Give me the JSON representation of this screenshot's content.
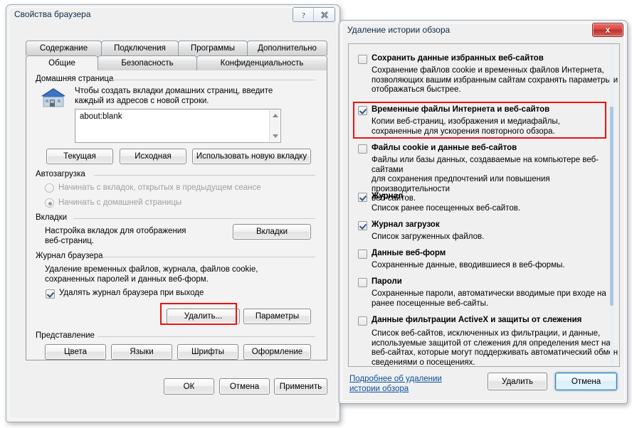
{
  "browser_properties": {
    "title": "Свойства браузера",
    "caption_buttons": [
      {
        "name": "help-button",
        "glyph": "?"
      },
      {
        "name": "close-button",
        "glyph": "✕"
      }
    ],
    "tabs_row1": [
      "Содержание",
      "Подключения",
      "Программы",
      "Дополнительно"
    ],
    "tabs_row2": [
      "Общие",
      "Безопасность",
      "Конфиденциальность"
    ],
    "selected_tab": "Общие",
    "home_page": {
      "group_label": "Домашняя страница",
      "icon": "house-icon",
      "description_line1": "Чтобы создать вкладки домашних страниц, введите",
      "description_line2": "каждый из адресов с новой строки.",
      "textarea_value": "about:blank",
      "buttons": [
        "Текущая",
        "Исходная",
        "Использовать новую вкладку"
      ]
    },
    "autostart": {
      "group_label": "Автозагрузка",
      "options": [
        {
          "label": "Начинать с вкладок, открытых в предыдущем сеансе",
          "checked": false
        },
        {
          "label": "Начинать с домашней страницы",
          "checked": true
        }
      ]
    },
    "tabs_section": {
      "group_label": "Вкладки",
      "description_line1": "Настройка вкладок для отображения",
      "description_line2": "веб-страниц.",
      "button": "Вкладки"
    },
    "history": {
      "group_label": "Журнал браузера",
      "description_line1": "Удаление временных файлов, журнала, файлов cookie,",
      "description_line2": "сохраненных паролей и данных веб-форм.",
      "checkbox_label": "Удалять журнал браузера при выходе",
      "checkbox_checked": true,
      "delete_button": "Удалить...",
      "settings_button": "Параметры"
    },
    "appearance": {
      "group_label": "Представление",
      "buttons": [
        "Цвета",
        "Языки",
        "Шрифты",
        "Оформление"
      ]
    },
    "footer_buttons": [
      "ОК",
      "Отмена",
      "Применить"
    ]
  },
  "delete_history": {
    "title": "Удаление истории обзора",
    "close_button_glyph": "x",
    "items": [
      {
        "title": "Сохранить данные избранных веб-сайтов",
        "checked": false,
        "desc": "Сохранение файлов cookie и временных файлов Интернета, позволяющих вашим избранным сайтам сохранять параметры и отображаться быстрее.",
        "desc_lines": [
          "Сохранение файлов cookie и временных файлов Интернета,",
          "позволяющих вашим избранным сайтам сохранять параметры и",
          "отображаться быстрее."
        ]
      },
      {
        "title": "Временные файлы Интернета и веб-сайтов",
        "checked": true,
        "highlighted": true,
        "desc_lines": [
          "Копии веб-страниц, изображения и медиафайлы,",
          "сохраненные для ускорения повторного обзора."
        ]
      },
      {
        "title": "Файлы cookie и данные веб-сайтов",
        "checked": false,
        "desc_lines": [
          "Файлы или базы данных, создаваемые на компьютере веб-сайтами",
          "для сохранения предпочтений или повышения производительности",
          "веб-сайтов."
        ]
      },
      {
        "title": "Журнал",
        "checked": true,
        "desc_lines": [
          "Список ранее посещенных веб-сайтов."
        ]
      },
      {
        "title": "Журнал загрузок",
        "checked": true,
        "desc_lines": [
          "Список загруженных файлов."
        ]
      },
      {
        "title": "Данные веб-форм",
        "checked": false,
        "desc_lines": [
          "Сохраненные данные, вводившиеся в веб-формы."
        ]
      },
      {
        "title": "Пароли",
        "checked": false,
        "desc_lines": [
          "Сохраненные пароли, автоматически вводимые при входе на",
          "ранее посещенные веб-сайты."
        ]
      },
      {
        "title": "Данные фильтрации ActiveX и защиты от слежения",
        "checked": false,
        "desc_lines": [
          "Список веб-сайтов, исключенных из фильтрации, и данные,",
          "используемые защитой от слежения для определения мест на",
          "веб-сайтах, которые могут поддерживать автоматический обмен",
          "сведениями о посещениях."
        ]
      }
    ],
    "link_line1": "Подробнее об удалении",
    "link_line2": "истории обзора",
    "delete_button": "Удалить",
    "cancel_button": "Отмена"
  },
  "colors": {
    "highlight": "#ee1111",
    "link": "#0b4f9e",
    "focus_ring": "#3c7fb1",
    "dialog_bg": "#f0f0f0",
    "panel_bg": "#f3f3f3"
  }
}
